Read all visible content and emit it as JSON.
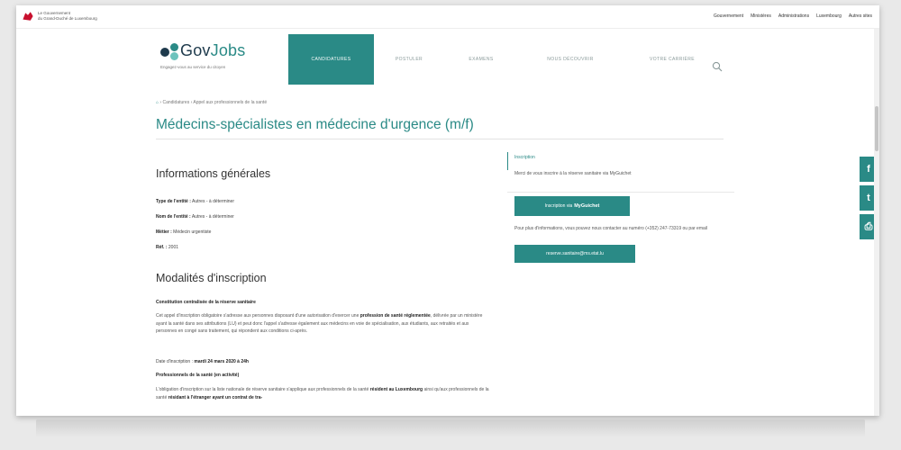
{
  "gov": {
    "name_line1": "Le Gouvernement",
    "name_line2": "du Grand-Duché de Luxembourg"
  },
  "top_links": [
    "Gouvernement",
    "Ministères",
    "Administrations",
    "Luxembourg",
    "Autres sites"
  ],
  "logo": {
    "part1": "Gov",
    "part2": "Jobs",
    "tagline": "Engagez-vous au service du citoyen"
  },
  "nav": [
    "Candidatures",
    "Postuler",
    "Examens",
    "Nous découvrir",
    "Votre carrière"
  ],
  "breadcrumb": {
    "home": "⌂",
    "path": "› Candidatures › Appel aux professionnels de la santé"
  },
  "title": "Médecins-spécialistes en médecine d'urgence (m/f)",
  "general": {
    "heading": "Informations générales",
    "rows": [
      {
        "label": "Type de l'entité :",
        "value": "Autres - à déterminer"
      },
      {
        "label": "Nom de l'entité :",
        "value": "Autres - à déterminer"
      },
      {
        "label": "Métier :",
        "value": "Médecin urgentiste"
      },
      {
        "label": "Réf. :",
        "value": "2001"
      }
    ]
  },
  "modalities": {
    "heading": "Modalités d'inscription",
    "sub1": "Constitution centralisée de la réserve sanitaire",
    "para1_a": "Cet appel d'inscription obligatoire s'adresse aux personnes disposant d'une autorisation d'exercer une ",
    "para1_b": "profession de santé réglementée",
    "para1_c": ", délivrée par un ministère ayant la santé dans ses attributions (LU) et peut donc l'appel s'adresse également aux médecins en voie de spécialisation, aux étudiants, aux retraités et aux personnes en congé sans traitement, qui répondent aux conditions ci-après.",
    "deadline_label": "Date d'inscription : ",
    "deadline_value": "mardi 24 mars 2020 à 24h",
    "sub2": "Professionnels de la santé (en activité)",
    "para2_a": "L'obligation d'inscription sur la liste nationale de réserve sanitaire s'applique aux professionnels de la santé ",
    "para2_b": "résident au Luxembourg",
    "para2_c": " ainsi qu'aux professionnels de la santé ",
    "para2_d": "résidant à l'étranger ayant un contrat de tra-"
  },
  "aside": {
    "label": "Inscription",
    "text": "Merci de vous inscrire à la réserve sanitaire via MyGuichet",
    "btn_prefix": "Inscription via",
    "btn_brand": "MyGuichet",
    "info": "Pour plus d'informations, vous pouvez nous contacter au numéro (+352) 247-73319 ou par email",
    "email": "reserve.sanitaire@ms.etat.lu"
  },
  "social": [
    "f",
    "t",
    "⎙"
  ],
  "colors": {
    "accent": "#2a8a86",
    "dark": "#1e3a4c"
  }
}
